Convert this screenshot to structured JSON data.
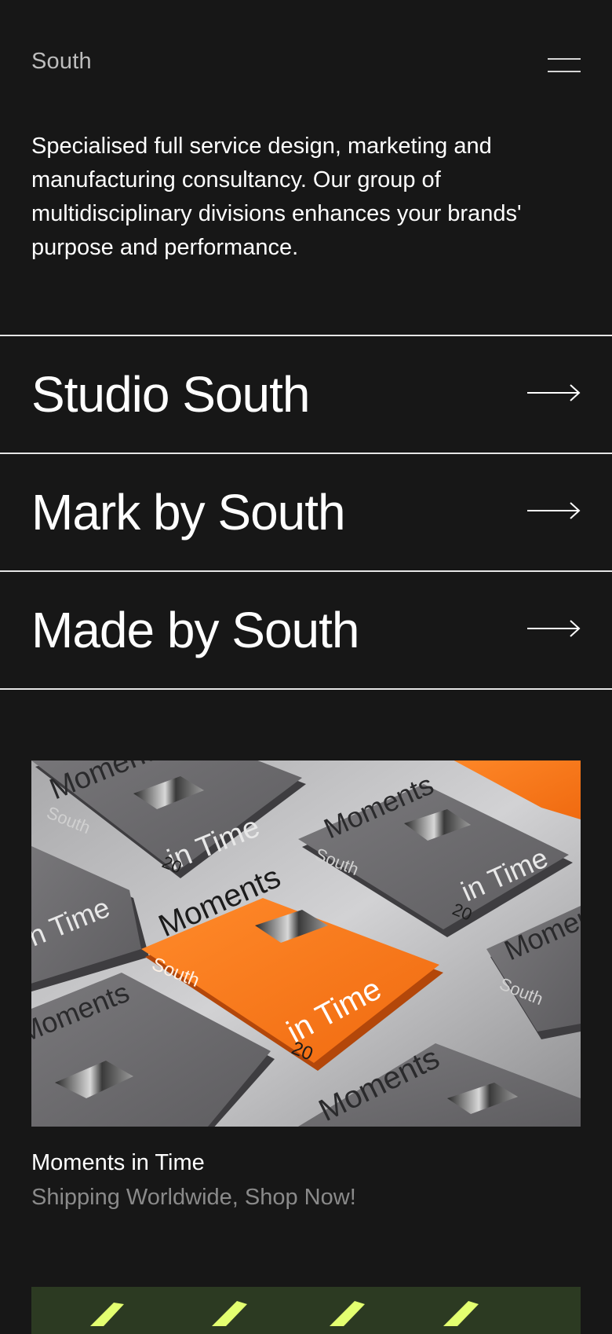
{
  "header": {
    "logo": "South",
    "menu_icon": "hamburger-icon"
  },
  "intro": {
    "text": "Specialised full service design, marketing and manufacturing consultancy. Our group of multidisciplinary divisions enhances your brands' purpose and performance."
  },
  "divisions": [
    {
      "label": "Studio South",
      "icon": "arrow-right-icon"
    },
    {
      "label": "Mark by South",
      "icon": "arrow-right-icon"
    },
    {
      "label": "Made by South",
      "icon": "arrow-right-icon"
    }
  ],
  "product": {
    "title": "Moments in Time",
    "subtitle": "Shipping Worldwide, Shop Now!",
    "image_text": {
      "word1": "Moments",
      "word2": "in Time",
      "brand": "South",
      "number": "20"
    }
  },
  "colors": {
    "background": "#171717",
    "text": "#ffffff",
    "muted_text": "#8a8a8a",
    "accent_orange": "#ff7a1a",
    "book_grey": "#6e6d70",
    "next_card_green": "#2c3a22",
    "next_card_accent": "#e3ff70"
  }
}
